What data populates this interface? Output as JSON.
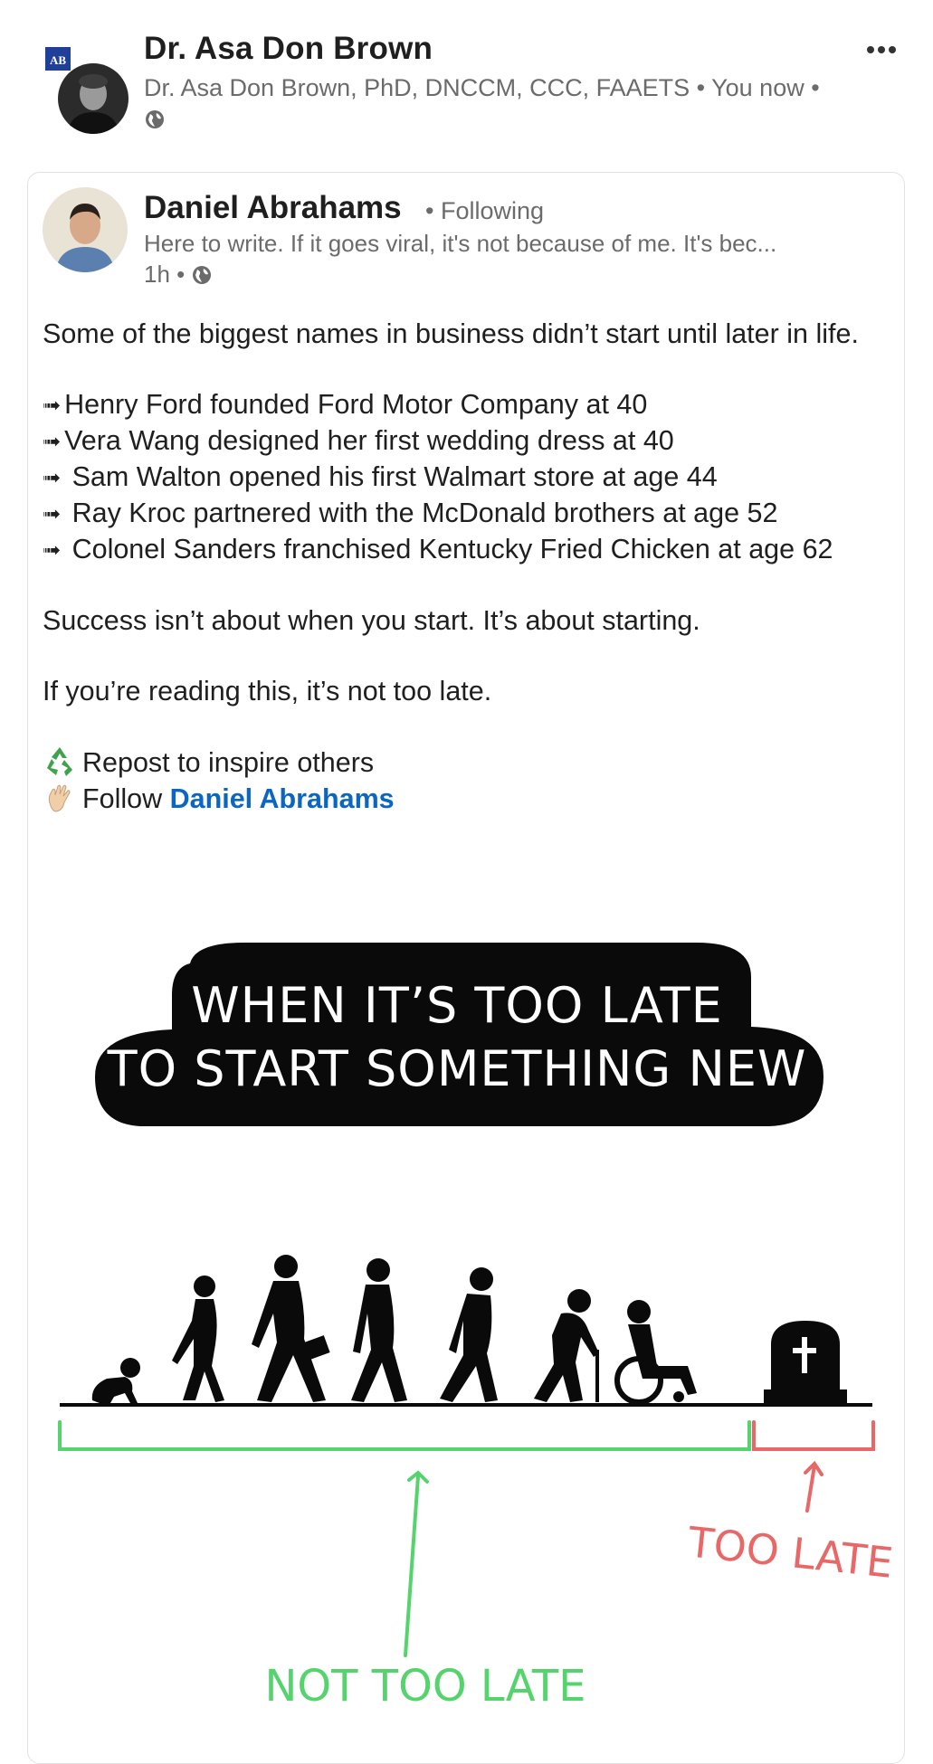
{
  "header": {
    "name": "Dr. Asa Don Brown",
    "subtitle": "Dr. Asa Don Brown, PhD, DNCCM, CCC, FAAETS • You now •",
    "logo_text": "AB",
    "more_icon": "more-horizontal-icon"
  },
  "shared_post": {
    "author": "Daniel Abrahams",
    "follow_status": "• Following",
    "headline": "Here to write. If it goes viral, it's not because of me. It's bec...",
    "time": "1h •",
    "intro": "Some of the biggest names in business didn’t start until later in life.",
    "list": [
      "Henry Ford founded Ford Motor Company at 40",
      "Vera Wang designed her first wedding dress at 40",
      " Sam Walton opened his first Walmart store at age 44",
      " Ray Kroc partnered with the McDonald brothers at age 52",
      " Colonel Sanders franchised Kentucky Fried Chicken at age 62"
    ],
    "line_success": "Success isn’t about when you start. It’s about starting.",
    "line_reading": "If you’re reading this, it’s not too late.",
    "cta_repost": "Repost to inspire others",
    "cta_follow_prefix": "Follow ",
    "cta_follow_name": "Daniel Abrahams",
    "arrow_glyph": "➟"
  },
  "illustration": {
    "banner_line1": "WHEN IT’S TOO LATE",
    "banner_line2": "TO START SOMETHING NEW",
    "label_not_too_late": "NOT TOO LATE",
    "label_too_late": "TOO LATE",
    "colors": {
      "green": "#55d36d",
      "red": "#e86767",
      "black": "#0a0a0a"
    }
  },
  "colors": {
    "link": "#0a66c2",
    "meta": "#6b6b6b",
    "text": "#1f1f1f"
  }
}
